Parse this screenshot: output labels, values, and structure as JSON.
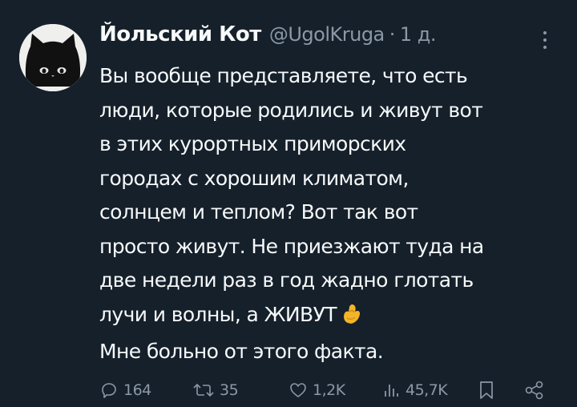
{
  "tweet": {
    "display_name": "Йольский Кот",
    "handle": "@UgolKruga",
    "separator": "·",
    "time": "1 д.",
    "lines": [
      "Вы вообще представляете, что есть",
      "люди, которые родились и живут вот",
      "в этих курортных приморских",
      "городах с хорошим климатом,",
      "солнцем и теплом? Вот так вот",
      "просто живут. Не приезжают туда на",
      "две недели раз в год жадно глотать",
      "лучи и волны, а ЖИВУТ",
      "Мне больно от этого факта."
    ],
    "emoji": "pinching-hand"
  },
  "actions": {
    "replies": "164",
    "retweets": "35",
    "likes": "1,2K",
    "views": "45,7K"
  },
  "colors": {
    "background": "#15202b",
    "text": "#f7f9f9",
    "secondary": "#8b98a5",
    "emoji": "#f4b42a"
  },
  "icons": [
    "more-icon",
    "reply-icon",
    "retweet-icon",
    "like-icon",
    "views-icon",
    "bookmark-icon",
    "share-icon"
  ]
}
